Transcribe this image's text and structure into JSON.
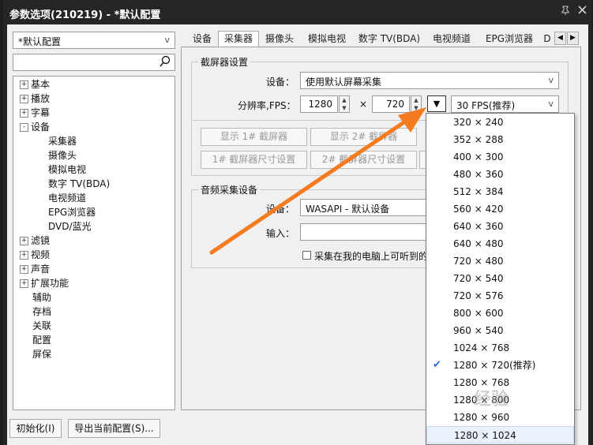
{
  "window": {
    "title": "参数选项(210219) - *默认配置",
    "pin_icon": "pin-icon",
    "close_icon": "close-icon"
  },
  "config_combo": {
    "value": "*默认配置"
  },
  "search": {
    "value": ""
  },
  "tree": {
    "items": [
      {
        "label": "基本",
        "expander": "+"
      },
      {
        "label": "播放",
        "expander": "+"
      },
      {
        "label": "字幕",
        "expander": "+"
      },
      {
        "label": "设备",
        "expander": "-"
      },
      {
        "label": "采集器"
      },
      {
        "label": "摄像头"
      },
      {
        "label": "模拟电视"
      },
      {
        "label": "数字 TV(BDA)"
      },
      {
        "label": "电视频道"
      },
      {
        "label": "EPG浏览器"
      },
      {
        "label": "DVD/蓝光"
      },
      {
        "label": "滤镜",
        "expander": "+"
      },
      {
        "label": "视频",
        "expander": "+"
      },
      {
        "label": "声音",
        "expander": "+"
      },
      {
        "label": "扩展功能",
        "expander": "+"
      },
      {
        "label": "辅助"
      },
      {
        "label": "存档"
      },
      {
        "label": "关联"
      },
      {
        "label": "配置"
      },
      {
        "label": "屏保"
      }
    ]
  },
  "tabs": [
    "设备",
    "采集器",
    "摄像头",
    "模拟电视",
    "数字 TV(BDA)",
    "电视频道",
    "EPG浏览器",
    "D"
  ],
  "screen_capture": {
    "group_title": "截屏器设置",
    "device_label": "设备：",
    "device_value": "使用默认屏幕采集",
    "resolution_label": "分辨率,FPS：",
    "width": "1280",
    "times": "×",
    "height": "720",
    "fps_value": "30 FPS(推荐)",
    "btn_show1": "显示 1# 截屏器",
    "btn_show2": "显示 2# 截屏器",
    "btn_size1": "1# 截屏器尺寸设置",
    "btn_size2": "2# 截屏器尺寸设置"
  },
  "audio_capture": {
    "group_title": "音频采集设备",
    "device_label": "设备：",
    "device_value": "WASAPI - 默认设备",
    "input_label": "输入：",
    "input_value": "",
    "checkbox_label": "采集在我的电脑上可听到的"
  },
  "bottom": {
    "init_button": "初始化(I)",
    "export_button": "导出当前配置(S)..."
  },
  "resolution_dropdown": {
    "selected": "1280 × 720(推荐)",
    "options": [
      "320 × 240",
      "352 × 288",
      "400 × 300",
      "480 × 360",
      "512 × 384",
      "560 × 420",
      "640 × 360",
      "640 × 480",
      "720 × 480",
      "720 × 540",
      "720 × 576",
      "800 × 600",
      "960 × 540",
      "1024 × 768",
      "1280 × 720(推荐)",
      "1280 × 768",
      "1280 × 800",
      "1280 × 960",
      "1280 × 1024"
    ]
  },
  "watermark": "经验",
  "colors": {
    "titlebar": "#262626",
    "arrow": "#f47b20",
    "check": "#2a6cd6"
  }
}
